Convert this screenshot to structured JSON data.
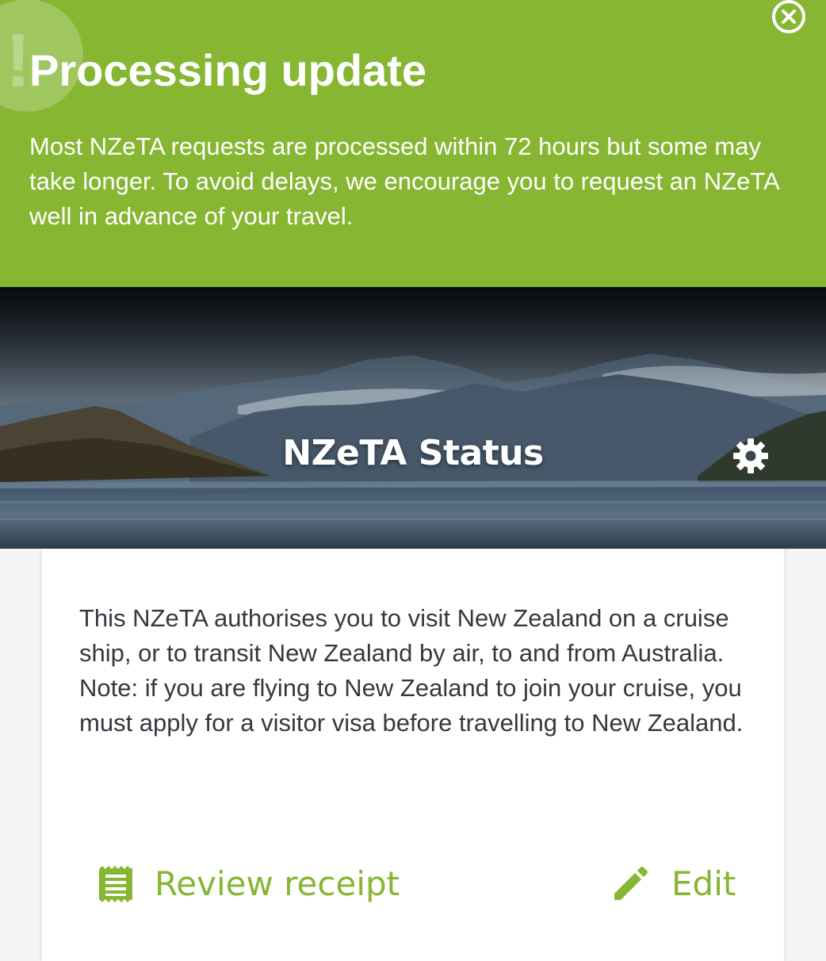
{
  "banner": {
    "badge_glyph": "!",
    "title": "Processing update",
    "message": "Most NZeTA requests are processed within 72 hours but some may take longer. To avoid delays, we encourage you to request an NZeTA well in advance of your travel.",
    "close_icon": "close-circle-icon",
    "background_color": "#86b632"
  },
  "header": {
    "title": "NZeTA Status",
    "settings_icon": "gear-icon",
    "image": "mountain-lake-landscape"
  },
  "card": {
    "message": "This NZeTA authorises you to visit New Zealand on a cruise ship, or to transit New Zealand by air, to and from Australia. Note: if you are flying to New Zealand to join your cruise, you must apply for a visitor visa before travelling to New Zealand.",
    "actions": {
      "review_receipt": {
        "label": "Review receipt",
        "icon": "receipt-icon"
      },
      "edit": {
        "label": "Edit",
        "icon": "pencil-icon"
      }
    },
    "accent_color": "#86b632"
  }
}
